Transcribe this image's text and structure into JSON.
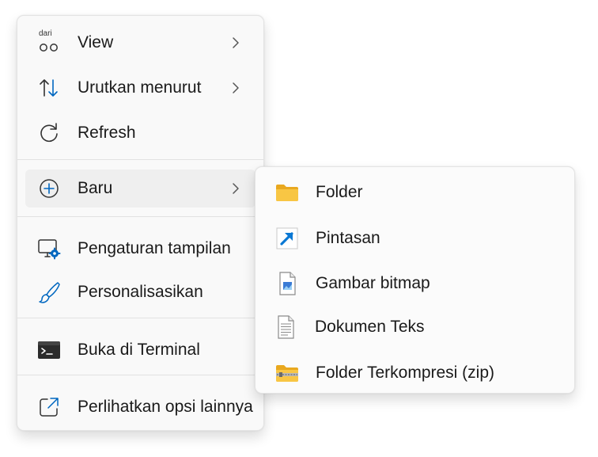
{
  "main_menu": {
    "items": [
      {
        "label": "View",
        "icon": "view-icon",
        "icon_text": "dari",
        "has_submenu": true
      },
      {
        "label": "Urutkan menurut",
        "icon": "sort-icon",
        "has_submenu": true
      },
      {
        "label": "Refresh",
        "icon": "refresh-icon",
        "has_submenu": false
      },
      {
        "label": "Baru",
        "icon": "plus-circle-icon",
        "has_submenu": true,
        "highlighted": true
      },
      {
        "label": "Pengaturan tampilan",
        "icon": "display-settings-icon",
        "has_submenu": false
      },
      {
        "label": "Personalisasikan",
        "icon": "brush-icon",
        "has_submenu": false
      },
      {
        "label": "Buka di Terminal",
        "icon": "terminal-icon",
        "has_submenu": false
      },
      {
        "label": "Perlihatkan opsi lainnya",
        "icon": "more-options-icon",
        "has_submenu": false
      }
    ]
  },
  "sub_menu": {
    "items": [
      {
        "label": "Folder",
        "icon": "folder-icon"
      },
      {
        "label": "Pintasan",
        "icon": "shortcut-icon"
      },
      {
        "label": "Gambar bitmap",
        "icon": "bitmap-file-icon"
      },
      {
        "label": "Dokumen Teks",
        "icon": "text-document-icon"
      },
      {
        "label": "Folder Terkompresi (zip)",
        "icon": "zip-folder-icon"
      }
    ]
  },
  "colors": {
    "accent_blue": "#0067c0",
    "folder_yellow": "#f8c644",
    "highlight_bg": "#efefef",
    "menu_bg": "#f9f9f9"
  }
}
